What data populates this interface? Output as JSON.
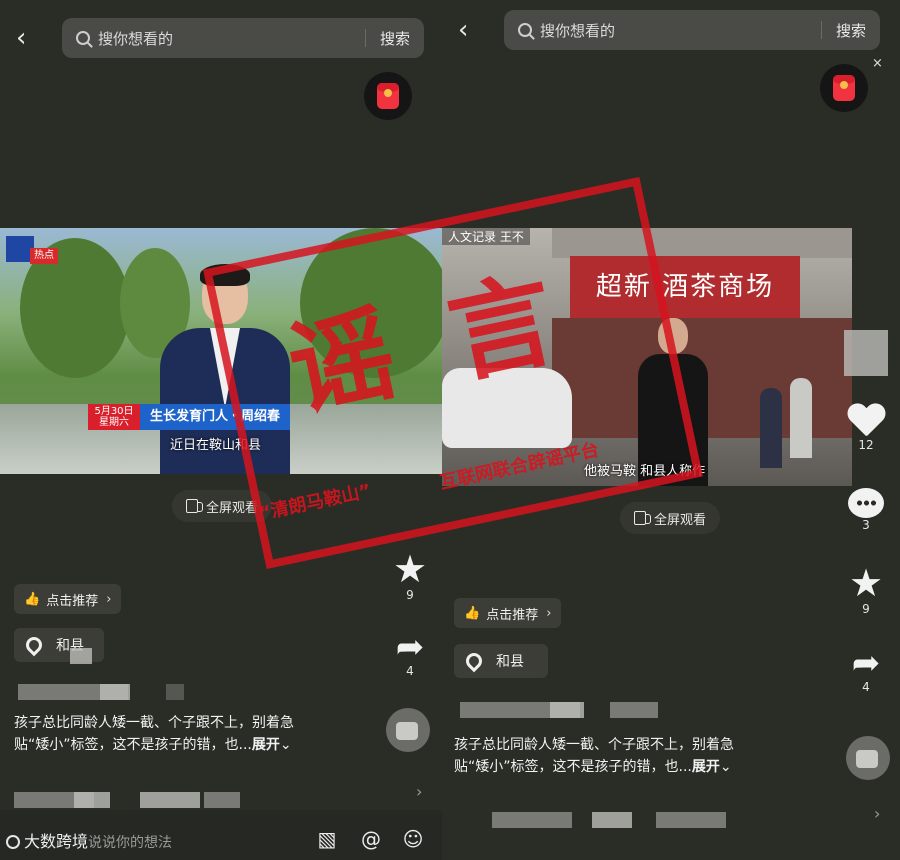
{
  "colors": {
    "app_bg": "#2a2c26",
    "stamp_red": "#d6141e",
    "search_bg": "#4a4b47"
  },
  "search": {
    "placeholder": "搜你想看的",
    "button": "搜索"
  },
  "left": {
    "news_tag": "热点",
    "lower_third_date": "5月30日",
    "lower_third_weekday": "星期六",
    "lower_third_title": "生长发育门人・周绍春",
    "subtitle": "近日在鞍山和县",
    "fullscreen": "全屏观看",
    "recommend": "点击推荐",
    "location": "和县",
    "desc_line1": "孩子总比同龄人矮一截、个子跟不上，别着急",
    "desc_line2": "贴“矮小”标签，这不是孩子的错，也...",
    "expand": "展开",
    "star_count": "9",
    "share_count": "4",
    "brand": "大数跨境",
    "input_hint": "说说你的想法"
  },
  "right": {
    "top_caption": "人文记录 王不",
    "shop_sign": "超新 酒茶商场",
    "subtitle": "他被马鞍 和县人称作",
    "fullscreen": "全屏观看",
    "recommend": "点击推荐",
    "location": "和县",
    "desc_line1": "孩子总比同龄人矮一截、个子跟不上，别着急",
    "desc_line2": "贴“矮小”标签，这不是孩子的错，也...",
    "expand": "展开",
    "like_count": "12",
    "comment_count": "3",
    "star_count": "9",
    "share_count": "4"
  },
  "stamp": {
    "big1": "谣",
    "big2": "言",
    "quote": "“清朗马鞍山”",
    "platform": "互联网联合辟谣平台"
  },
  "icons": {
    "back": "chevron-left-icon",
    "search": "search-icon",
    "close": "close-icon",
    "red_packet": "red-packet-icon",
    "like": "heart-icon",
    "comment": "comment-icon",
    "favorite": "star-icon",
    "share": "share-icon",
    "location": "location-pin-icon",
    "image": "image-icon",
    "mention": "at-icon",
    "emoji": "emoji-icon"
  }
}
